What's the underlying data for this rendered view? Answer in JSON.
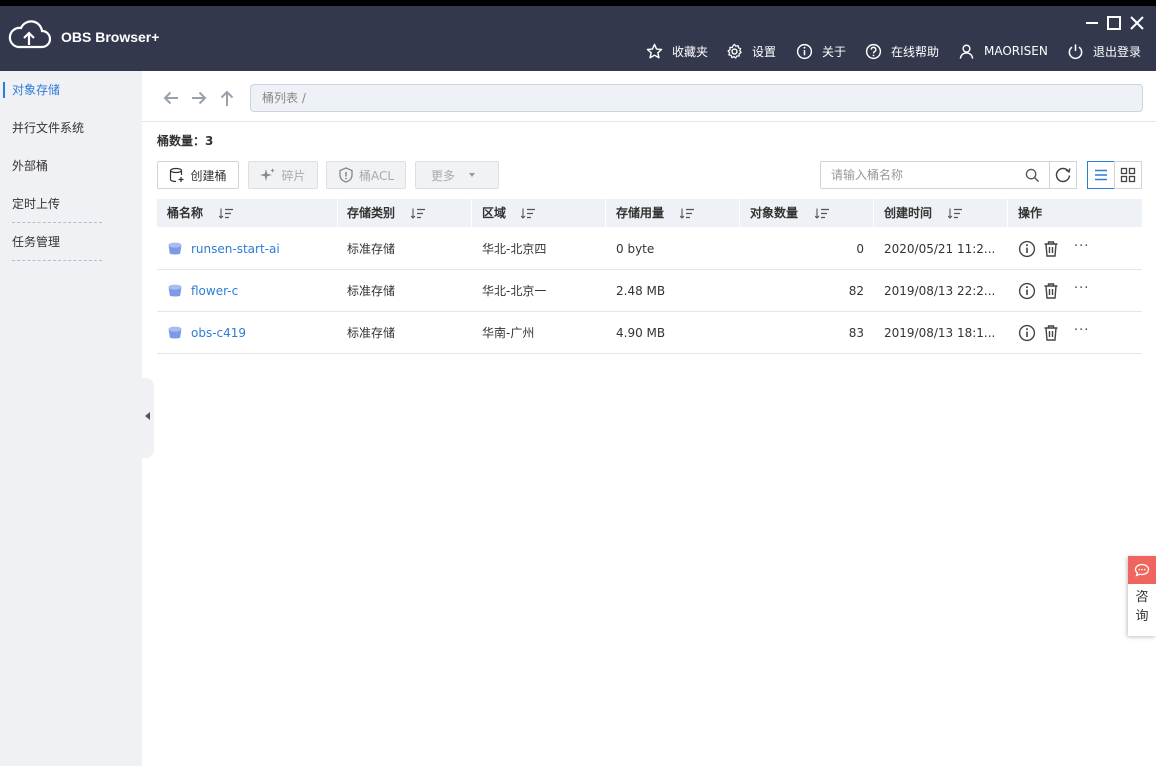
{
  "app": {
    "title": "OBS Browser+"
  },
  "topnav": {
    "favorites": "收藏夹",
    "settings": "设置",
    "about": "关于",
    "help": "在线帮助",
    "user": "MAORISEN",
    "logout": "退出登录"
  },
  "sidebar": {
    "items": [
      {
        "label": "对象存储",
        "active": true
      },
      {
        "label": "并行文件系统"
      },
      {
        "label": "外部桶"
      },
      {
        "label": "定时上传"
      },
      {
        "label": "任务管理"
      }
    ]
  },
  "breadcrumb": {
    "text": "桶列表 /"
  },
  "summary": {
    "label": "桶数量：",
    "count": "3"
  },
  "toolbar": {
    "create": "创建桶",
    "fragments": "碎片",
    "acl": "桶ACL",
    "more": "更多",
    "search_placeholder": "请输入桶名称"
  },
  "table": {
    "headers": {
      "name": "桶名称",
      "storage_class": "存储类别",
      "region": "区域",
      "usage": "存储用量",
      "objects": "对象数量",
      "created": "创建时间",
      "actions": "操作"
    },
    "rows": [
      {
        "name": "runsen-start-ai",
        "storage_class": "标准存储",
        "region": "华北-北京四",
        "usage": "0 byte",
        "objects": "0",
        "created": "2020/05/21 11:2..."
      },
      {
        "name": "flower-c",
        "storage_class": "标准存储",
        "region": "华北-北京一",
        "usage": "2.48 MB",
        "objects": "82",
        "created": "2019/08/13 22:2..."
      },
      {
        "name": "obs-c419",
        "storage_class": "标准存储",
        "region": "华南-广州",
        "usage": "4.90 MB",
        "objects": "83",
        "created": "2019/08/13 18:1..."
      }
    ],
    "more_glyph": "···"
  },
  "consult": {
    "line1": "咨",
    "line2": "询"
  },
  "colors": {
    "titlebar": "#33384d",
    "accent": "#2e7cd6",
    "sidebar": "#f0f1f5",
    "consult": "#f0655d"
  }
}
